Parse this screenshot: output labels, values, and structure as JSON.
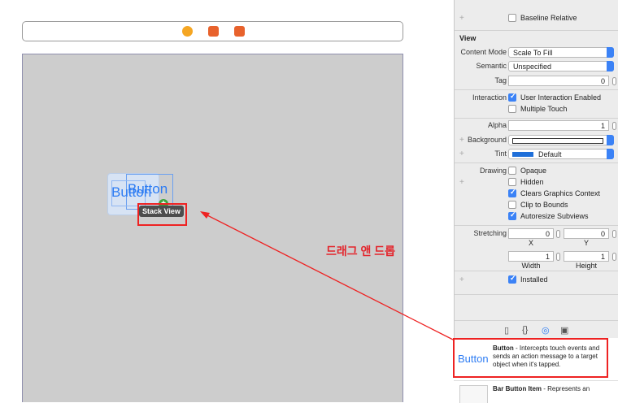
{
  "canvas": {
    "buttons": [
      "Button",
      "Button"
    ],
    "tooltip": "Stack View",
    "annotation": "드래그 앤 드롭"
  },
  "inspector": {
    "baseline_relative": "Baseline Relative",
    "view_title": "View",
    "content_mode": {
      "label": "Content Mode",
      "value": "Scale To Fill"
    },
    "semantic": {
      "label": "Semantic",
      "value": "Unspecified"
    },
    "tag": {
      "label": "Tag",
      "value": "0"
    },
    "interaction": {
      "label": "Interaction",
      "user_interaction": "User Interaction Enabled",
      "multiple_touch": "Multiple Touch"
    },
    "alpha": {
      "label": "Alpha",
      "value": "1"
    },
    "background": {
      "label": "Background"
    },
    "tint": {
      "label": "Tint",
      "value": "Default"
    },
    "drawing": {
      "label": "Drawing",
      "opaque": "Opaque",
      "hidden": "Hidden",
      "clears": "Clears Graphics Context",
      "clip": "Clip to Bounds",
      "autoresize": "Autoresize Subviews"
    },
    "stretching": {
      "label": "Stretching",
      "x": "0",
      "y": "0",
      "width": "1",
      "height": "1",
      "x_label": "X",
      "y_label": "Y",
      "w_label": "Width",
      "h_label": "Height"
    },
    "installed": "Installed",
    "plus": "+"
  },
  "library": {
    "button_title": "Button",
    "button_desc_bold": "Button",
    "button_desc": " - Intercepts touch events and sends an action message to a target object when it's tapped.",
    "bar_item_bold": "Bar Button Item",
    "bar_item_desc": " - Represents an"
  },
  "colors": {
    "accent": "#2d7cf3",
    "annotation_red": "#e22",
    "checkbox_blue": "#3b82f6"
  }
}
